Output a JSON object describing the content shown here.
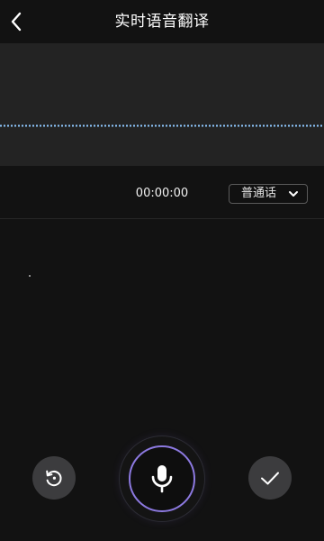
{
  "header": {
    "title": "实时语音翻译",
    "back_icon": "chevron-left-icon"
  },
  "recorder": {
    "timer": "00:00:00",
    "language": "普通话",
    "language_icon": "chevron-down-icon"
  },
  "actions": {
    "reset_icon": "rotate-ccw-icon",
    "mic_icon": "microphone-icon",
    "confirm_icon": "checkmark-icon"
  },
  "colors": {
    "background": "#121212",
    "wave_panel": "#232323",
    "waveform": "#8fc8ff",
    "accent": "#8c79e0",
    "button_bg": "#3c3c3e"
  }
}
